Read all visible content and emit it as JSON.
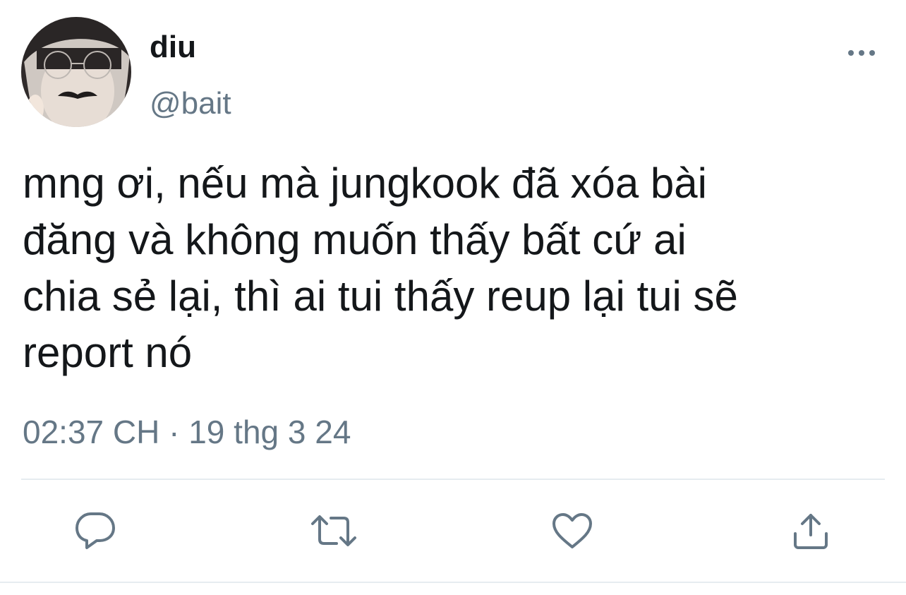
{
  "user": {
    "display_name": "diu",
    "handle": "@bait",
    "avatar_icon": "profile-photo"
  },
  "tweet": {
    "text": "mng ơi, nếu mà jungkook đã xóa bài\nđăng và không muốn thấy bất cứ ai\nchia sẻ lại, thì ai tui thấy reup lại tui sẽ\nreport nó",
    "timestamp": "02:37 CH · 19 thg 3 24"
  },
  "actions": [
    {
      "name": "reply",
      "icon": "reply-icon"
    },
    {
      "name": "retweet",
      "icon": "retweet-icon"
    },
    {
      "name": "like",
      "icon": "heart-icon"
    },
    {
      "name": "share",
      "icon": "share-icon"
    }
  ],
  "colors": {
    "text": "#14171a",
    "secondary": "#657786",
    "divider": "#e6ecf0"
  }
}
